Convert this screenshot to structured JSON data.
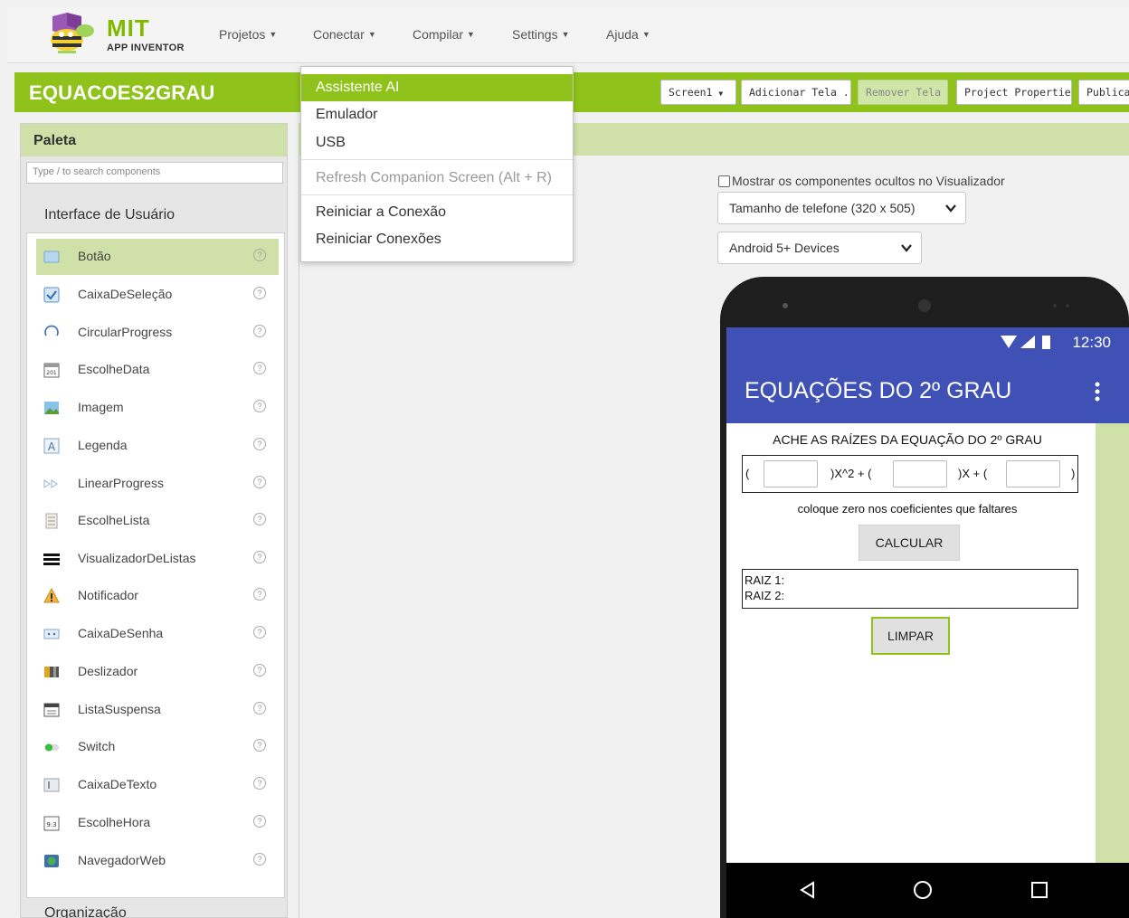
{
  "app": {
    "logo_main": "MIT",
    "logo_sub": "APP INVENTOR"
  },
  "nav": [
    {
      "label": "Projetos"
    },
    {
      "label": "Conectar"
    },
    {
      "label": "Compilar"
    },
    {
      "label": "Settings"
    },
    {
      "label": "Ajuda"
    }
  ],
  "project": {
    "title": "EQUACOES2GRAU",
    "screen_select": "Screen1",
    "add_screen": "Adicionar Tela ...",
    "remove_screen": "Remover Tela",
    "properties": "Project Properties",
    "publish": "Publicar"
  },
  "connect_menu": {
    "items": [
      {
        "label": "Assistente AI",
        "state": "highlighted"
      },
      {
        "label": "Emulador",
        "state": "normal"
      },
      {
        "label": "USB",
        "state": "normal"
      },
      {
        "label": "Refresh Companion Screen (Alt + R)",
        "state": "disabled"
      },
      {
        "label": "Reiniciar a Conexão",
        "state": "normal"
      },
      {
        "label": "Reiniciar Conexões",
        "state": "normal"
      }
    ]
  },
  "palette": {
    "title": "Paleta",
    "search_placeholder": "Type / to search components",
    "section_title": "Interface de Usuário",
    "next_section_title": "Organização",
    "components": [
      {
        "label": "Botão",
        "icon": "button-icon",
        "selected": true
      },
      {
        "label": "CaixaDeSeleção",
        "icon": "checkbox-icon"
      },
      {
        "label": "CircularProgress",
        "icon": "circular-progress-icon"
      },
      {
        "label": "EscolheData",
        "icon": "date-picker-icon"
      },
      {
        "label": "Imagem",
        "icon": "image-icon"
      },
      {
        "label": "Legenda",
        "icon": "label-icon"
      },
      {
        "label": "LinearProgress",
        "icon": "linear-progress-icon"
      },
      {
        "label": "EscolheLista",
        "icon": "list-picker-icon"
      },
      {
        "label": "VisualizadorDeListas",
        "icon": "list-view-icon"
      },
      {
        "label": "Notificador",
        "icon": "notifier-icon"
      },
      {
        "label": "CaixaDeSenha",
        "icon": "password-icon"
      },
      {
        "label": "Deslizador",
        "icon": "slider-icon"
      },
      {
        "label": "ListaSuspensa",
        "icon": "spinner-icon"
      },
      {
        "label": "Switch",
        "icon": "switch-icon"
      },
      {
        "label": "CaixaDeTexto",
        "icon": "textbox-icon"
      },
      {
        "label": "EscolheHora",
        "icon": "time-picker-icon"
      },
      {
        "label": "NavegadorWeb",
        "icon": "web-viewer-icon"
      }
    ],
    "help_glyph": "?"
  },
  "viewer": {
    "show_hidden_label": "Mostrar os componentes ocultos no Visualizador",
    "show_hidden_checked": false,
    "phone_size": "Tamanho de telefone (320 x 505)",
    "device_type": "Android 5+ Devices"
  },
  "phone": {
    "clock": "12:30",
    "app_title": "EQUAÇÕES DO 2º GRAU",
    "heading": "ACHE AS RAÍZES DA EQUAÇÃO DO 2º GRAU",
    "eq_open": "(",
    "eq_x2": ")X^2 + (",
    "eq_x": ")X + (",
    "eq_close": ")",
    "note": "coloque zero nos coeficientes que faltares",
    "calc_button": "CALCULAR",
    "root1": "RAIZ 1:",
    "root2": "RAIZ 2:",
    "clear_button": "LIMPAR"
  },
  "colors": {
    "brand_green": "#8fc21a",
    "light_green": "#cfe0a8",
    "phone_blue": "#3f51b5"
  }
}
